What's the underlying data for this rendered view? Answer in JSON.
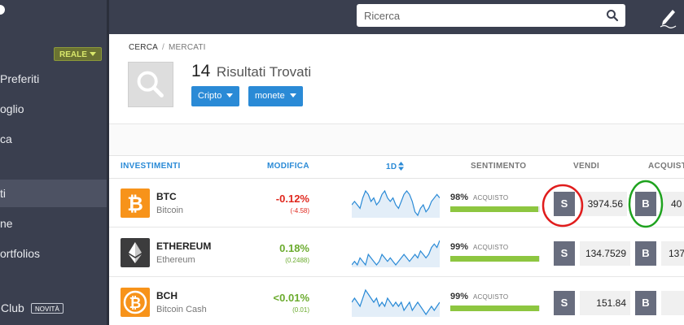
{
  "topbar": {
    "search_placeholder": "Ricerca"
  },
  "sidebar": {
    "mode_badge": "REALE",
    "items": [
      {
        "label": "Preferiti"
      },
      {
        "label": "oglio"
      },
      {
        "label": "ca"
      },
      {
        "label": "ti"
      },
      {
        "label": "ne"
      },
      {
        "label": "ortfolios"
      },
      {
        "label": "Club",
        "badge": "NOVITÀ"
      }
    ]
  },
  "breadcrumb": {
    "root": "CERCA",
    "separator": "/",
    "current": "MERCATI"
  },
  "results": {
    "count": "14",
    "label": "Risultati Trovati"
  },
  "filters": [
    {
      "label": "Cripto"
    },
    {
      "label": "monete"
    }
  ],
  "table": {
    "headers": {
      "investments": "INVESTIMENTI",
      "change": "MODIFICA",
      "period": "1D",
      "sentiment": "SENTIMENTO",
      "sell": "VENDI",
      "buy": "ACQUIST"
    },
    "sell_label": "S",
    "buy_label": "B",
    "rows": [
      {
        "symbol": "BTC",
        "name": "Bitcoin",
        "change_pct": "-0.12%",
        "change_abs": "(-4.58)",
        "direction": "neg",
        "sentiment_pct": "98%",
        "sentiment_level": 0.98,
        "sentiment_label": "ACQUISTO",
        "sell_price": "3974.56",
        "buy_price": "40",
        "logo_color": "#f7931a",
        "logo_icon": "bitcoin-icon",
        "spark": [
          5,
          6,
          5,
          4,
          7,
          9,
          8,
          6,
          7,
          5,
          6,
          8,
          9,
          7,
          6,
          7,
          5,
          4,
          6,
          8,
          9,
          8,
          6,
          3,
          2,
          4,
          5,
          3,
          4,
          6,
          7,
          8,
          7
        ]
      },
      {
        "symbol": "ETHEREUM",
        "name": "Ethereum",
        "change_pct": "0.18%",
        "change_abs": "(0.2488)",
        "direction": "pos",
        "sentiment_pct": "99%",
        "sentiment_level": 0.99,
        "sentiment_label": "ACQUISTO",
        "sell_price": "134.7529",
        "buy_price": "137",
        "logo_color": "#3c3c3d",
        "logo_icon": "ethereum-icon",
        "spark": [
          3,
          4,
          3,
          5,
          4,
          3,
          6,
          5,
          4,
          3,
          4,
          6,
          5,
          4,
          5,
          4,
          3,
          4,
          5,
          6,
          5,
          4,
          5,
          6,
          5,
          7,
          6,
          5,
          6,
          8,
          9,
          8,
          10
        ]
      },
      {
        "symbol": "BCH",
        "name": "Bitcoin Cash",
        "change_pct": "<0.01%",
        "change_abs": "(0.01)",
        "direction": "pos",
        "sentiment_pct": "99%",
        "sentiment_level": 0.99,
        "sentiment_label": "ACQUISTO",
        "sell_price": "151.84",
        "buy_price": "",
        "logo_color": "#f7931a",
        "logo_icon": "bitcoin-cash-icon",
        "spark": [
          6,
          7,
          6,
          5,
          7,
          9,
          8,
          7,
          6,
          7,
          5,
          6,
          5,
          7,
          6,
          5,
          6,
          5,
          6,
          4,
          5,
          6,
          4,
          5,
          6,
          5,
          4,
          3,
          4,
          5,
          4,
          5,
          6
        ]
      }
    ]
  },
  "annotations": {
    "sell_circle_color": "#e01c1c",
    "buy_circle_color": "#1ea21e"
  }
}
